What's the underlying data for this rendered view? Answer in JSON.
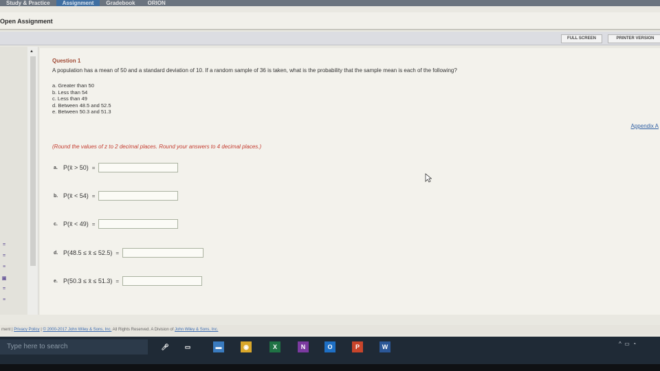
{
  "top_nav": {
    "tabs": [
      {
        "label": "Study & Practice",
        "active": false
      },
      {
        "label": "Assignment",
        "active": true
      },
      {
        "label": "Gradebook",
        "active": false
      },
      {
        "label": "ORION",
        "active": false
      }
    ]
  },
  "page_title": "Open Assignment",
  "toolbar": {
    "full_screen": "FULL SCREEN",
    "printer_version": "PRINTER VERSION"
  },
  "question": {
    "title": "Question 1",
    "text": "A population has a mean of 50 and a standard deviation of 10. If a random sample of 36 is taken, what is the probability that the sample mean is each of the following?",
    "parts": [
      "a. Greater than 50",
      "b. Less than 54",
      "c. Less than 49",
      "d. Between 48.5 and 52.5",
      "e. Between 50.3 and 51.3"
    ],
    "appendix_link": "Appendix A",
    "instructions": "(Round the values of z to 2 decimal places. Round your answers to 4 decimal places.)",
    "answers": [
      {
        "label": "a.",
        "expr": "P(x̄ > 50)",
        "eq": "=",
        "value": ""
      },
      {
        "label": "b.",
        "expr": "P(x̄ < 54)",
        "eq": "=",
        "value": ""
      },
      {
        "label": "c.",
        "expr": "P(x̄ < 49)",
        "eq": "=",
        "value": ""
      },
      {
        "label": "d.",
        "expr": "P(48.5 ≤ x̄ ≤ 52.5)",
        "eq": "=",
        "value": ""
      },
      {
        "label": "e.",
        "expr": "P(50.3 ≤ x̄ ≤ 51.3)",
        "eq": "=",
        "value": ""
      }
    ]
  },
  "footer": {
    "lead": "ment",
    "privacy": "Privacy Policy",
    "copyright": "© 2000-2017 John Wiley & Sons, Inc.",
    "rights": "All Rights Reserved. A Division of",
    "company_link": "John Wiley & Sons, Inc."
  },
  "taskbar": {
    "search_placeholder": "Type here to search",
    "apps": [
      {
        "icon": "microphone-icon",
        "glyph": "🎤︎",
        "color": "#1f2a36"
      },
      {
        "icon": "task-view-icon",
        "glyph": "▭",
        "color": "#1f2a36"
      },
      {
        "icon": "file-explorer-icon",
        "glyph": "▬",
        "color": "#3a7bbf"
      },
      {
        "icon": "chrome-icon",
        "glyph": "◉",
        "color": "#d9a72a"
      },
      {
        "icon": "excel-icon",
        "glyph": "X",
        "color": "#1f7244"
      },
      {
        "icon": "onenote-icon",
        "glyph": "N",
        "color": "#7b3aa0"
      },
      {
        "icon": "outlook-icon",
        "glyph": "O",
        "color": "#1e6fc4"
      },
      {
        "icon": "powerpoint-icon",
        "glyph": "P",
        "color": "#c8452b"
      },
      {
        "icon": "word-icon",
        "glyph": "W",
        "color": "#2b5797"
      }
    ],
    "tray_text": "^"
  }
}
